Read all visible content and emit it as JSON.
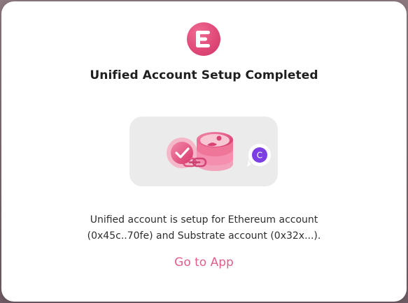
{
  "dialog": {
    "title": "Unified Account Setup Completed",
    "description_line1": "Unified account is setup for Ethereum account",
    "description_line2": "(0x45c..70fe) and Substrate account (0x32x...).",
    "cta_label": "Go to App",
    "avatar_letter": "C"
  },
  "colors": {
    "accent": "#e0608a",
    "brand_gradient_start": "#ee6b93",
    "brand_gradient_end": "#cf3668",
    "avatar": "#7b3fe4",
    "card_background": "#ebebeb"
  },
  "icons": {
    "logo": "brand-e-logo-icon",
    "success": "check-circle-icon",
    "link": "link-icon",
    "account": "account-stack-icon",
    "avatar": "avatar-badge-icon"
  }
}
